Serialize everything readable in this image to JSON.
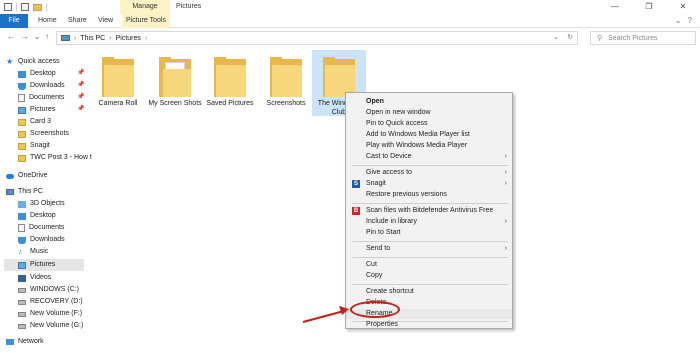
{
  "ribbon": {
    "contextual_tab": "Manage",
    "window_title": "Pictures",
    "tabs": [
      "File",
      "Home",
      "Share",
      "View",
      "Picture Tools"
    ]
  },
  "address": {
    "crumbs": [
      "This PC",
      "Pictures"
    ],
    "search_placeholder": "Search Pictures"
  },
  "nav": {
    "items": [
      {
        "label": "Quick access",
        "icon": "star-icon"
      },
      {
        "label": "Desktop",
        "icon": "desktop-icon",
        "pinned": true
      },
      {
        "label": "Downloads",
        "icon": "download-icon",
        "pinned": true
      },
      {
        "label": "Documents",
        "icon": "documents-icon",
        "pinned": true
      },
      {
        "label": "Pictures",
        "icon": "pictures-icon",
        "pinned": true
      },
      {
        "label": "Card 3",
        "icon": "folder-icon"
      },
      {
        "label": "Screenshots",
        "icon": "folder-icon"
      },
      {
        "label": "Snagit",
        "icon": "folder-icon"
      },
      {
        "label": "TWC Post 3 - How t",
        "icon": "folder-icon"
      },
      {
        "label": "OneDrive",
        "icon": "cloud-icon"
      },
      {
        "label": "This PC",
        "icon": "pc-icon"
      },
      {
        "label": "3D Objects",
        "icon": "3d-objects-icon"
      },
      {
        "label": "Desktop",
        "icon": "desktop-icon"
      },
      {
        "label": "Documents",
        "icon": "documents-icon"
      },
      {
        "label": "Downloads",
        "icon": "download-icon"
      },
      {
        "label": "Music",
        "icon": "music-icon"
      },
      {
        "label": "Pictures",
        "icon": "pictures-icon",
        "selected": true
      },
      {
        "label": "Videos",
        "icon": "videos-icon"
      },
      {
        "label": "WINDOWS (C:)",
        "icon": "drive-icon"
      },
      {
        "label": "RECOVERY (D:)",
        "icon": "drive-icon"
      },
      {
        "label": "New Volume (F:)",
        "icon": "drive-icon"
      },
      {
        "label": "New Volume (G:)",
        "icon": "drive-icon"
      },
      {
        "label": "Network",
        "icon": "network-icon"
      }
    ]
  },
  "folders": [
    {
      "label": "Camera Roll"
    },
    {
      "label": "My Screen Shots"
    },
    {
      "label": "Saved Pictures"
    },
    {
      "label": "Screenshots"
    },
    {
      "label": "The Windows Club",
      "selected": true
    }
  ],
  "context_menu": {
    "items": [
      {
        "label": "Open",
        "bold": true
      },
      {
        "label": "Open in new window"
      },
      {
        "label": "Pin to Quick access"
      },
      {
        "label": "Add to Windows Media Player list"
      },
      {
        "label": "Play with Windows Media Player"
      },
      {
        "label": "Cast to Device",
        "submenu": true
      },
      {
        "separator": true
      },
      {
        "label": "Give access to",
        "submenu": true
      },
      {
        "label": "Snagit",
        "submenu": true,
        "icon": "snagit-icon"
      },
      {
        "label": "Restore previous versions"
      },
      {
        "separator": true
      },
      {
        "label": "Scan files with Bitdefender Antivirus Free",
        "icon": "bitdefender-icon"
      },
      {
        "label": "Include in library",
        "submenu": true
      },
      {
        "label": "Pin to Start"
      },
      {
        "separator": true
      },
      {
        "label": "Send to",
        "submenu": true
      },
      {
        "separator": true
      },
      {
        "label": "Cut"
      },
      {
        "label": "Copy"
      },
      {
        "separator": true
      },
      {
        "label": "Create shortcut"
      },
      {
        "label": "Delete"
      },
      {
        "label": "Rename",
        "highlighted": true
      },
      {
        "separator": true
      },
      {
        "label": "Properties"
      }
    ]
  },
  "annotation": {
    "color": "#c0221d"
  }
}
